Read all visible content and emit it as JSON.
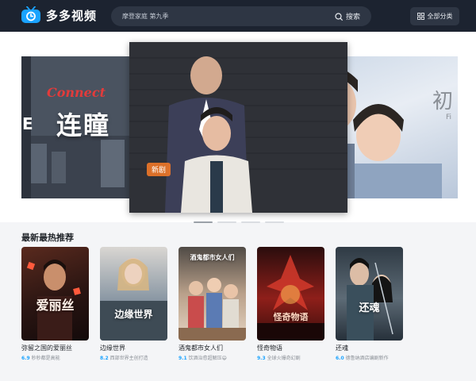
{
  "header": {
    "logo_text": "多多视频",
    "search_placeholder": "摩登家庭 第九季",
    "search_button": "搜索",
    "category_button": "全部分类"
  },
  "colors": {
    "topbar": "#1c2330",
    "accent": "#1aa3ff",
    "badge": "#f07828"
  },
  "carousel": {
    "left": {
      "brand": "Connect",
      "title": "连瞳"
    },
    "center": {
      "badge": "新剧"
    },
    "right": {
      "title": "初",
      "subtitle": "Fi"
    },
    "active_index": 0,
    "slide_count": 4
  },
  "section": {
    "title": "最新最热推荐"
  },
  "cards": [
    {
      "poster_text": "爱丽丝",
      "name": "弥留之国的爱丽丝",
      "score": "6.9",
      "desc": "秒秒都是高能"
    },
    {
      "poster_text": "边缘世界",
      "name": "边缘世界",
      "score": "8.2",
      "desc": "西部世界主创打造"
    },
    {
      "poster_text": "酒鬼都市女人们",
      "name": "酒鬼都市女人们",
      "score": "9.1",
      "desc": "饮酒治愈超解压😄"
    },
    {
      "poster_text": "怪奇物语",
      "name": "怪奇物语",
      "score": "9.3",
      "desc": "全球火爆奇幻剧"
    },
    {
      "poster_text": "还魂",
      "name": "还魂",
      "score": "6.0",
      "desc": "德鲁纳酒店编剧新作"
    }
  ]
}
